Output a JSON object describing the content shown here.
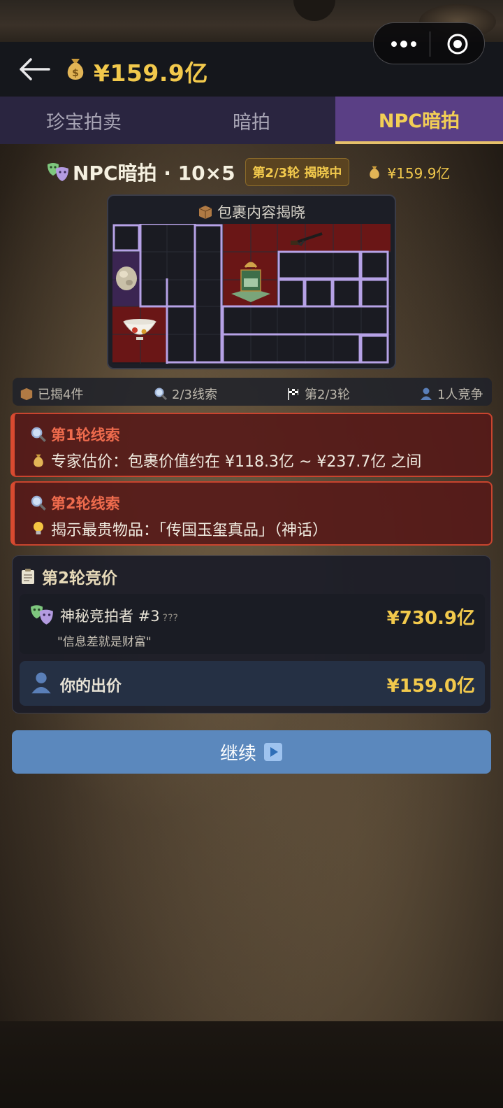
{
  "header": {
    "balance": "¥159.9亿",
    "back_icon": "back-arrow-icon",
    "money_icon": "money-bag-icon",
    "capsule_more_icon": "more-dots-icon",
    "capsule_close_icon": "target-circle-icon"
  },
  "tabs": [
    {
      "label": "珍宝拍卖",
      "active": false
    },
    {
      "label": "暗拍",
      "active": false
    },
    {
      "label": "NPC暗拍",
      "active": true
    }
  ],
  "title_row": {
    "title": "NPC暗拍 · 10×5",
    "round_badge": "第2/3轮 揭晓中",
    "balance": "¥159.9亿"
  },
  "package": {
    "title": "包裹内容揭晓",
    "revealed_items": [
      "rock-ore",
      "rifle",
      "treasure-chest-seal",
      "rooster-bowl"
    ]
  },
  "stats": {
    "revealed": "已揭4件",
    "clues": "2/3线索",
    "round": "第2/3轮",
    "competitors": "1人竞争"
  },
  "clues": [
    {
      "head": "第1轮线索",
      "text": "专家估价：包裹价值约在 ¥118.3亿 ~ ¥237.7亿 之间"
    },
    {
      "head": "第2轮线索",
      "text": "揭示最贵物品：「传国玉玺真品」（神话）"
    }
  ],
  "bidding": {
    "head": "第2轮竞价",
    "npc": {
      "name": "神秘竞拍者 #3",
      "tag": "???",
      "quote": "\"信息差就是财富\"",
      "price": "¥730.9亿"
    },
    "me": {
      "label": "你的出价",
      "price": "¥159.0亿"
    }
  },
  "continue_label": "继续",
  "colors": {
    "gold": "#f2c94c",
    "tab_active_bg": "#5a3f85",
    "clue_border": "#d84a30",
    "button_blue": "#5b88bd"
  }
}
